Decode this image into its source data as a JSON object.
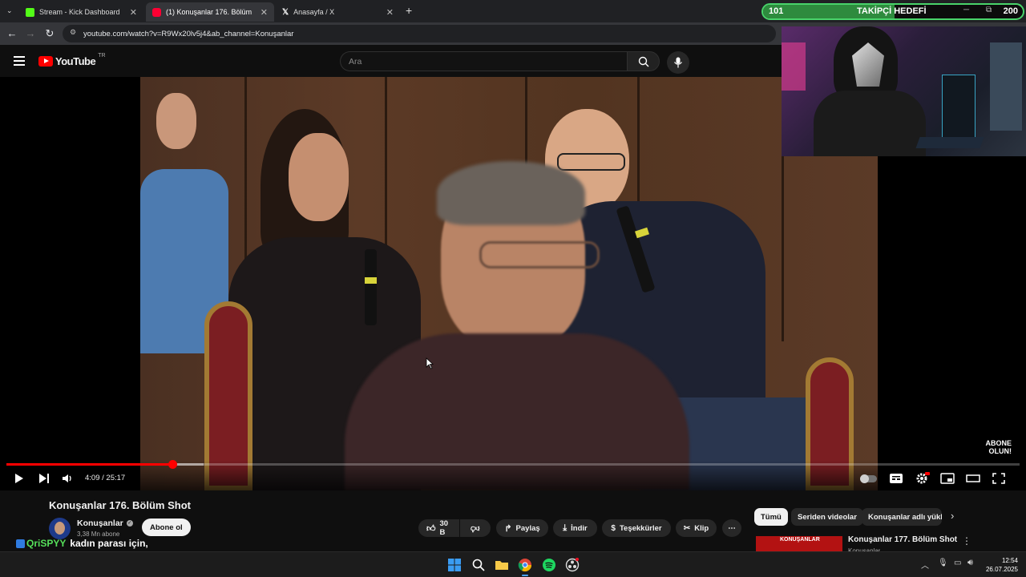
{
  "browser": {
    "tabs": [
      {
        "title": "Stream - Kick Dashboard",
        "color": "#53fc18"
      },
      {
        "title": "(1) Konuşanlar 176. Bölüm Shot",
        "color": "#ff0033"
      },
      {
        "title": "Anasayfa / X",
        "color": "#ffffff"
      }
    ],
    "url": "youtube.com/watch?v=R9Wx20lv5j4&ab_channel=Konuşanlar"
  },
  "youtube": {
    "logo": "YouTube",
    "region": "TR",
    "search_placeholder": "Ara"
  },
  "player": {
    "current_time": "4:09",
    "duration": "25:17",
    "time_label": "4:09 / 25:17",
    "progress_fraction": 0.164,
    "buffered_fraction": 0.195,
    "overlay_text": "ABONE OLUN!",
    "accent": "#ff0000"
  },
  "stream_goal": {
    "current": "101",
    "label": "TAKİPÇİ HEDEFİ",
    "target": "200",
    "fraction": 0.505,
    "color": "#49d36a"
  },
  "video_info": {
    "title": "Konuşanlar 176. Bölüm Shot",
    "channel": "Konuşanlar",
    "subscribers": "3,38 Mn abone",
    "subscribe_label": "Abone ol",
    "likes": "30 B",
    "share_label": "Paylaş",
    "download_label": "İndir",
    "thanks_label": "Teşekkürler",
    "clip_label": "Klip"
  },
  "chat_overlay": {
    "user": "QriSPYY",
    "message": "kadın parası için,"
  },
  "recommendations": {
    "chips": [
      "Tümü",
      "Seriden videolar",
      "Konuşanlar adlı yükle"
    ],
    "first_title": "Konuşanlar 177. Bölüm Shot",
    "first_channel": "Konuşanlar",
    "thumb_text": "KONUŞANLAR"
  },
  "taskbar": {
    "time": "12:54",
    "date": "26.07.2025"
  }
}
